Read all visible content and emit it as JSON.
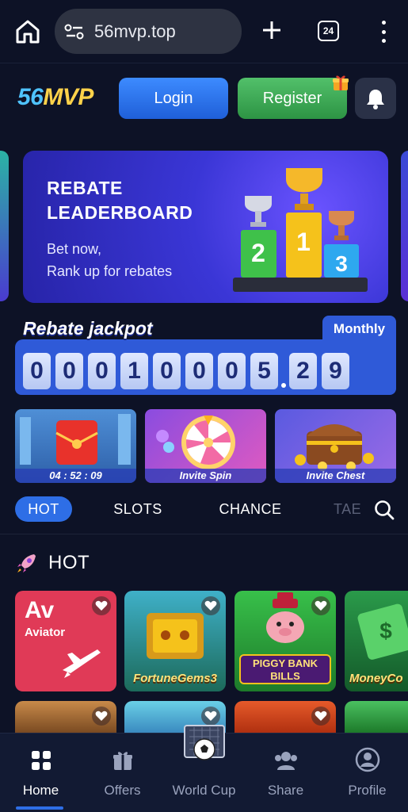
{
  "browser": {
    "url": "56mvp.top",
    "tab_count": "24"
  },
  "header": {
    "logo_part1": "56",
    "logo_part2": "MVP",
    "login_label": "Login",
    "register_label": "Register"
  },
  "banner": {
    "title_line1": "REBATE",
    "title_line2": "LEADERBOARD",
    "sub_line1": "Bet now,",
    "sub_line2": "Rank up for rebates",
    "podium": [
      "2",
      "1",
      "3"
    ]
  },
  "jackpot": {
    "title": "Rebate jackpot",
    "period": "Monthly",
    "digits": [
      "0",
      "0",
      "0",
      "1",
      "0",
      "0",
      "0",
      "5",
      "2",
      "9"
    ]
  },
  "promos": [
    {
      "label": "04 : 52 : 09"
    },
    {
      "label": "Invite Spin"
    },
    {
      "label": "Invite Chest"
    }
  ],
  "categories": {
    "items": [
      "HOT",
      "SLOTS",
      "CHANCE",
      "TAE"
    ]
  },
  "hot": {
    "title": "HOT",
    "games": [
      {
        "title": "Av",
        "subtitle": "Aviator"
      },
      {
        "title": "FortuneGems3"
      },
      {
        "title": "PIGGY BANK",
        "subtitle": "BILLS"
      },
      {
        "title": "MoneyCo"
      }
    ]
  },
  "nav": {
    "items": [
      "Home",
      "Offers",
      "World Cup",
      "Share",
      "Profile"
    ]
  },
  "colors": {
    "background": "#0d1226",
    "accent": "#2e6ee6",
    "login": "#3d8bff",
    "register": "#52c06a"
  }
}
